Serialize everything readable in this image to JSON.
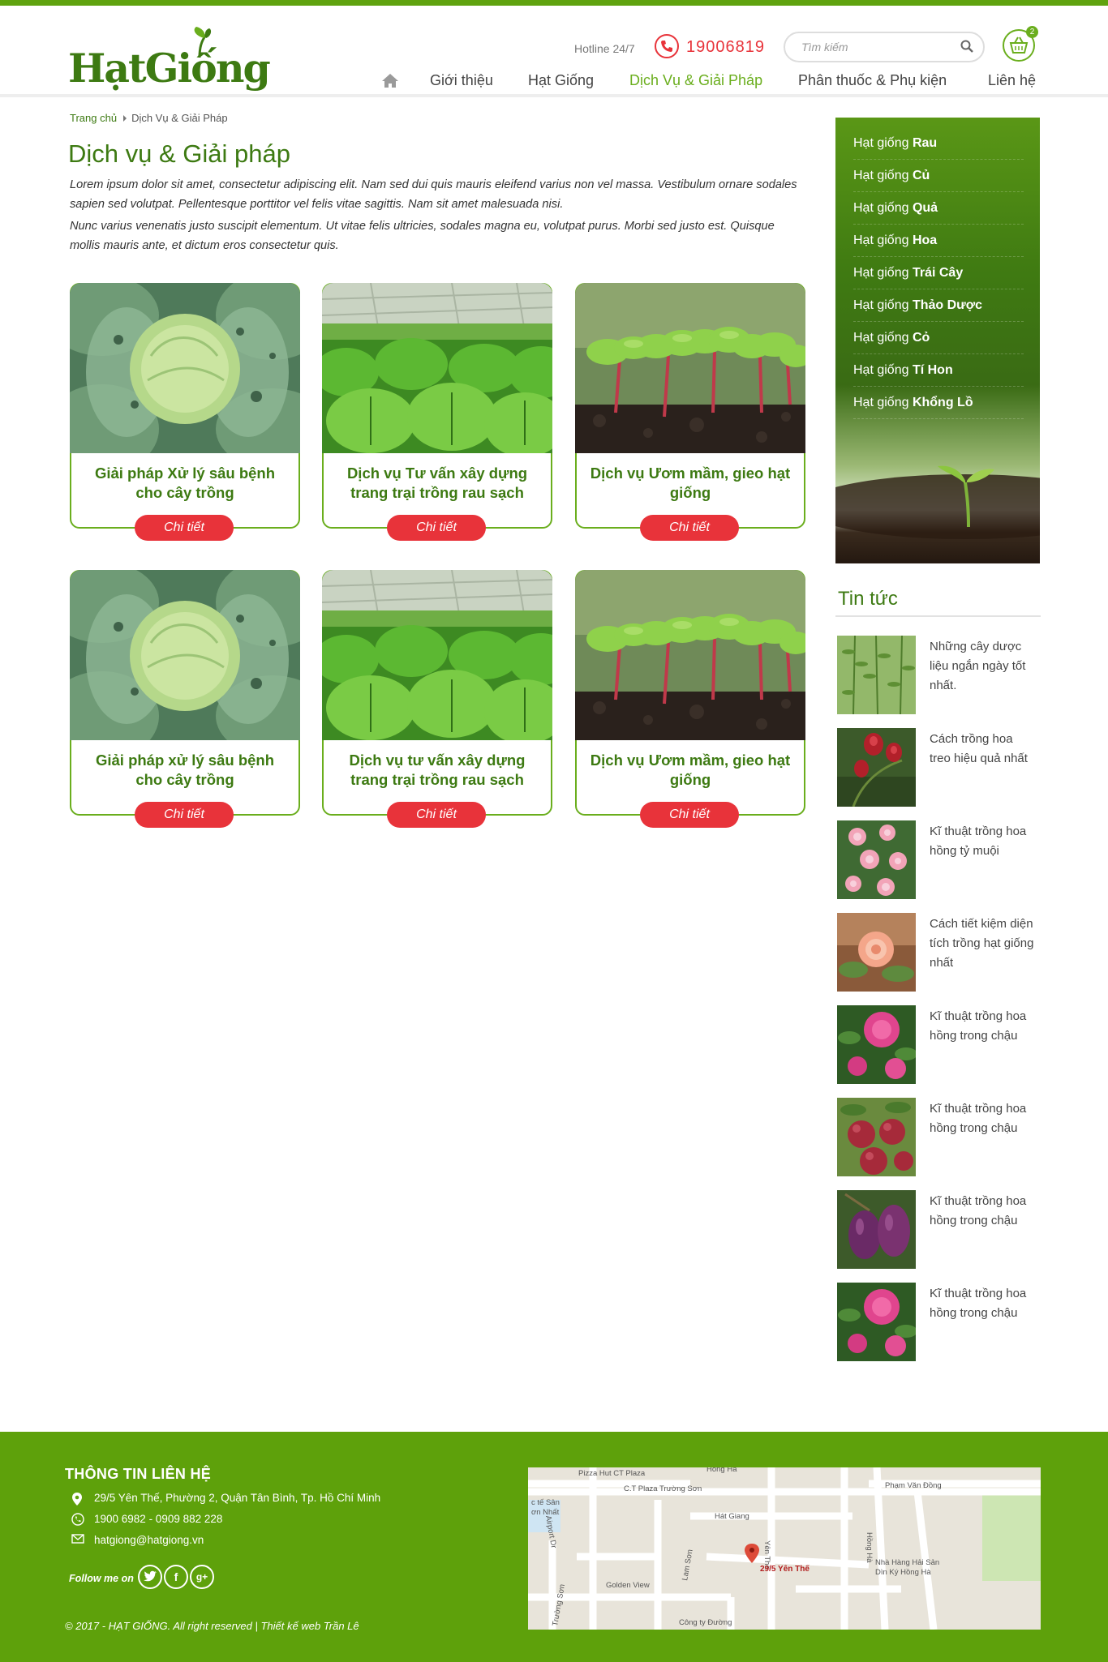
{
  "colors": {
    "brand_green": "#6aae1d",
    "dark_green": "#3d7a12",
    "red": "#e8333a",
    "footer_green": "#5ea10b"
  },
  "header": {
    "logo": "HạtGiống",
    "hotline_label": "Hotline 24/7",
    "phone": "19006819",
    "search_placeholder": "Tìm kiếm",
    "cart_count": "2",
    "nav": [
      "Giới thiệu",
      "Hạt Giống",
      "Dịch Vụ & Giải Pháp",
      "Phân thuốc & Phụ kiện",
      "Liên hệ"
    ],
    "nav_active": "Dịch Vụ & Giải Pháp"
  },
  "breadcrumb": {
    "home": "Trang chủ",
    "current": "Dịch Vụ & Giải Pháp"
  },
  "main": {
    "title": "Dịch vụ & Giải pháp",
    "intro": [
      "Lorem ipsum dolor sit amet, consectetur adipiscing elit. Nam sed dui quis mauris eleifend varius non vel massa. Vestibulum ornare sodales sapien sed volutpat. Pellentesque porttitor vel felis vitae sagittis. Nam sit amet malesuada nisi.",
      "Nunc varius venenatis justo suscipit elementum. Ut vitae felis ultricies, sodales magna eu, volutpat purus. Morbi sed justo est. Quisque mollis mauris ante, et dictum eros consectetur quis."
    ],
    "cards": [
      {
        "title": "Giải pháp Xử lý sâu bệnh cho cây trồng",
        "button": "Chi tiết",
        "image": "cabbage"
      },
      {
        "title": "Dịch vụ Tư vấn xây dựng trang trại trồng rau sạch",
        "button": "Chi tiết",
        "image": "greenhouse"
      },
      {
        "title": "Dịch vụ Ươm mầm, gieo hạt giống",
        "button": "Chi tiết",
        "image": "seedlings"
      },
      {
        "title": "Giải pháp xử lý sâu bệnh cho cây trồng",
        "button": "Chi tiết",
        "image": "cabbage"
      },
      {
        "title": "Dịch vụ tư vấn xây dựng trang trại trồng rau sạch",
        "button": "Chi tiết",
        "image": "greenhouse"
      },
      {
        "title": "Dịch vụ Ươm mầm, gieo hạt giống",
        "button": "Chi tiết",
        "image": "seedlings"
      }
    ]
  },
  "sidebar": {
    "categories": [
      {
        "prefix": "Hạt giống",
        "name": "Rau"
      },
      {
        "prefix": "Hạt giống",
        "name": "Củ"
      },
      {
        "prefix": "Hạt giống",
        "name": "Quả"
      },
      {
        "prefix": "Hạt giống",
        "name": "Hoa"
      },
      {
        "prefix": "Hạt giống",
        "name": "Trái Cây"
      },
      {
        "prefix": "Hạt giống",
        "name": "Thảo Dược"
      },
      {
        "prefix": "Hạt giống",
        "name": "Cỏ"
      },
      {
        "prefix": "Hạt giống",
        "name": "Tí Hon"
      },
      {
        "prefix": "Hạt giống",
        "name": "Khổng Lồ"
      }
    ],
    "news_title": "Tin tức",
    "news": [
      {
        "title": "Những cây dược liệu ngắn ngày tốt nhất.",
        "image": "herb"
      },
      {
        "title": "Cách trồng hoa treo hiệu quả nhất",
        "image": "hibiscus"
      },
      {
        "title": "Kĩ thuật trồng hoa hồng tỷ muội",
        "image": "pink-roses"
      },
      {
        "title": "Cách tiết kiệm diện tích trồng hạt giống nhất",
        "image": "peach-rose"
      },
      {
        "title": "Kĩ thuật trồng hoa hồng trong chậu",
        "image": "magenta-rose"
      },
      {
        "title": "Kĩ thuật trồng hoa hồng trong chậu",
        "image": "plums"
      },
      {
        "title": "Kĩ thuật trồng hoa hồng trong chậu",
        "image": "purple-fruit"
      },
      {
        "title": "Kĩ thuật trồng hoa hồng trong chậu",
        "image": "magenta-rose"
      }
    ]
  },
  "footer": {
    "heading": "THÔNG TIN LIÊN HỆ",
    "address": "29/5 Yên Thế, Phường 2, Quận Tân Bình, Tp. Hồ Chí Minh",
    "phones": "1900 6982 - 0909 882 228",
    "email": "hatgiong@hatgiong.vn",
    "follow": "Follow me on",
    "copyright": "© 2017 - HẠT GIỐNG. All right reserved   |   Thiết kế web Trần Lê",
    "map": {
      "pin_label": "29/5 Yên Thế",
      "labels": [
        "Pizza Hut CT Plaza",
        "C.T Plaza Trường Sơn",
        "Hát Giang",
        "Phạm Văn Đồng",
        "Hồng Hà",
        "Yên Thế",
        "Lam Sơn",
        "Golden View",
        "Nhà Hàng Hải Sản",
        "Dìn Ký Hồng Hà",
        "Công ty Đường",
        "Trường Sơn",
        "Hồng Hà",
        "Airport Dr",
        "c tế Sân",
        "ơn Nhất"
      ]
    }
  }
}
